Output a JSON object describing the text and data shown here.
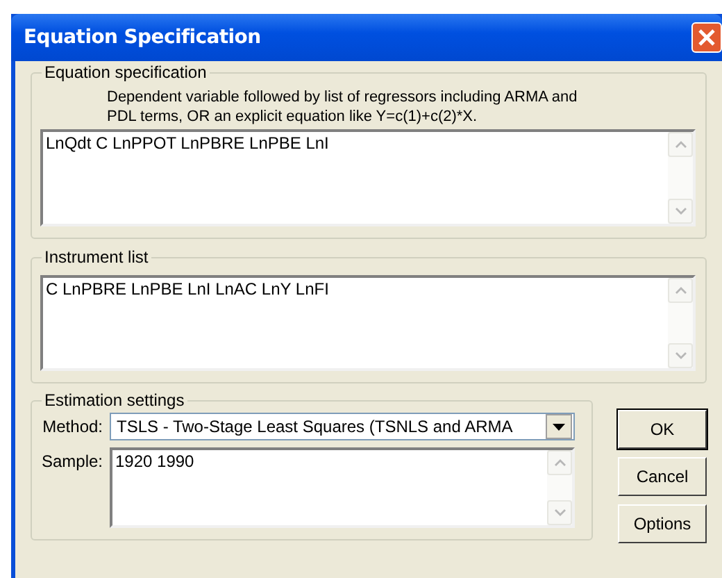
{
  "window": {
    "title": "Equation Specification"
  },
  "equation_specification": {
    "label": "Equation specification",
    "description": "Dependent variable followed by list of regressors including ARMA and PDL terms, OR an explicit equation like Y=c(1)+c(2)*X.",
    "value": "LnQdt C LnPPOT LnPBRE LnPBE LnI"
  },
  "instrument_list": {
    "label": "Instrument list",
    "value": "C LnPBRE LnPBE LnI LnAC LnY LnFI"
  },
  "estimation_settings": {
    "label": "Estimation settings",
    "method_label": "Method:",
    "method": "TSLS  -  Two-Stage Least Squares (TSNLS and ARMA",
    "sample_label": "Sample:",
    "sample": "1920 1990"
  },
  "buttons": [
    {
      "label": "OK",
      "default": true
    },
    {
      "label": "Cancel",
      "default": false
    },
    {
      "label": "Options",
      "default": false
    }
  ]
}
